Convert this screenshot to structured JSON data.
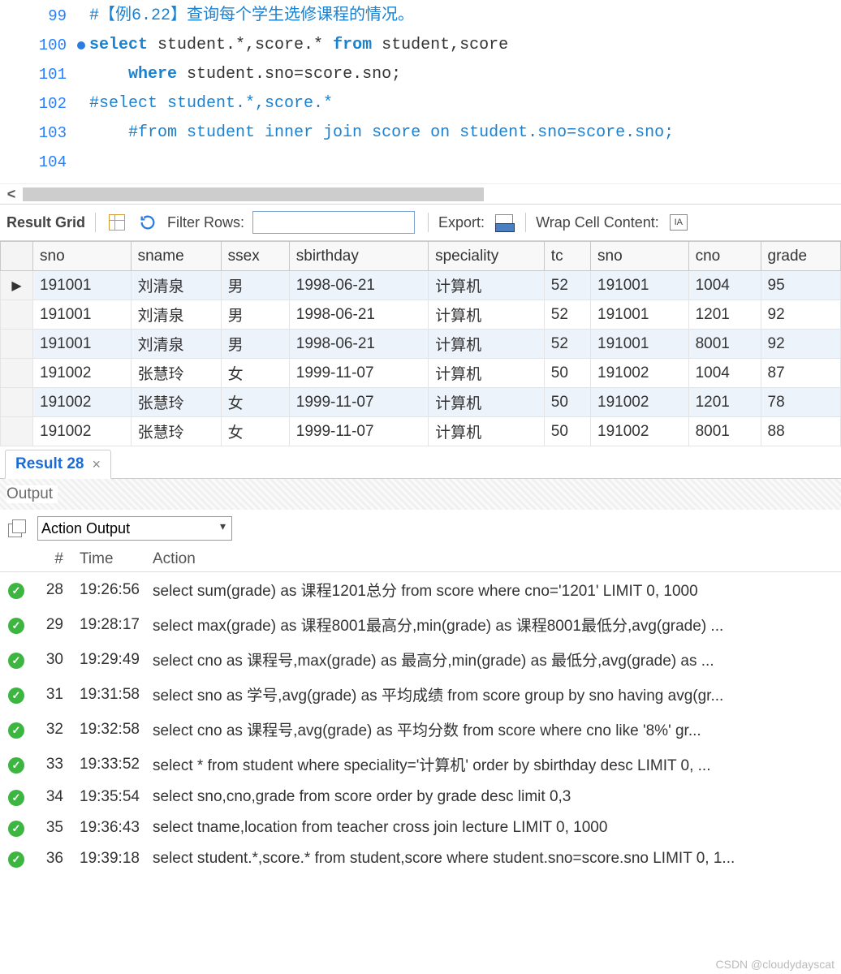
{
  "editor": {
    "lines": [
      {
        "num": "99",
        "bp": false,
        "indent": "",
        "segs": [
          [
            "cm",
            "#【例6.22】查询每个学生选修课程的情况。"
          ]
        ]
      },
      {
        "num": "100",
        "bp": true,
        "indent": "",
        "segs": [
          [
            "kw",
            "select"
          ],
          [
            "def",
            " student.*,score.* "
          ],
          [
            "kw",
            "from"
          ],
          [
            "def",
            " student,score"
          ]
        ]
      },
      {
        "num": "101",
        "bp": false,
        "indent": "    ",
        "segs": [
          [
            "kw",
            "where"
          ],
          [
            "def",
            " student.sno=score.sno;"
          ]
        ]
      },
      {
        "num": "102",
        "bp": false,
        "indent": "",
        "segs": [
          [
            "cm",
            "#select student.*,score.*"
          ]
        ]
      },
      {
        "num": "103",
        "bp": false,
        "indent": "    ",
        "segs": [
          [
            "cm",
            "#from student inner join score on student.sno=score.sno;"
          ]
        ]
      },
      {
        "num": "104",
        "bp": false,
        "indent": "",
        "segs": []
      }
    ]
  },
  "resultbar": {
    "title": "Result Grid",
    "filter_label": "Filter Rows:",
    "filter_value": "",
    "export_label": "Export:",
    "wrap_label": "Wrap Cell Content:",
    "wrap_icon_text": "IA"
  },
  "grid": {
    "columns": [
      "sno",
      "sname",
      "ssex",
      "sbirthday",
      "speciality",
      "tc",
      "sno",
      "cno",
      "grade"
    ],
    "rows": [
      [
        "191001",
        "刘清泉",
        "男",
        "1998-06-21",
        "计算机",
        "52",
        "191001",
        "1004",
        "95"
      ],
      [
        "191001",
        "刘清泉",
        "男",
        "1998-06-21",
        "计算机",
        "52",
        "191001",
        "1201",
        "92"
      ],
      [
        "191001",
        "刘清泉",
        "男",
        "1998-06-21",
        "计算机",
        "52",
        "191001",
        "8001",
        "92"
      ],
      [
        "191002",
        "张慧玲",
        "女",
        "1999-11-07",
        "计算机",
        "50",
        "191002",
        "1004",
        "87"
      ],
      [
        "191002",
        "张慧玲",
        "女",
        "1999-11-07",
        "计算机",
        "50",
        "191002",
        "1201",
        "78"
      ],
      [
        "191002",
        "张慧玲",
        "女",
        "1999-11-07",
        "计算机",
        "50",
        "191002",
        "8001",
        "88"
      ]
    ],
    "row_marker": "▶"
  },
  "restab": {
    "label": "Result 28",
    "close": "×"
  },
  "output": {
    "header": "Output",
    "select_value": "Action Output",
    "columns": {
      "num": "#",
      "time": "Time",
      "action": "Action"
    },
    "rows": [
      {
        "n": "28",
        "t": "19:26:56",
        "a": "select sum(grade) as 课程1201总分 from score where cno='1201' LIMIT 0, 1000"
      },
      {
        "n": "29",
        "t": "19:28:17",
        "a": "select max(grade) as 课程8001最高分,min(grade) as 课程8001最低分,avg(grade) ..."
      },
      {
        "n": "30",
        "t": "19:29:49",
        "a": "select cno as 课程号,max(grade) as 最高分,min(grade) as 最低分,avg(grade) as ..."
      },
      {
        "n": "31",
        "t": "19:31:58",
        "a": "select sno as 学号,avg(grade) as 平均成绩 from score group by sno having avg(gr..."
      },
      {
        "n": "32",
        "t": "19:32:58",
        "a": "select cno as 课程号,avg(grade) as 平均分数 from score where cno like '8%'    gr..."
      },
      {
        "n": "33",
        "t": "19:33:52",
        "a": "select * from student where speciality='计算机'    order by sbirthday desc LIMIT 0, ..."
      },
      {
        "n": "34",
        "t": "19:35:54",
        "a": "select sno,cno,grade from score order by grade desc    limit 0,3"
      },
      {
        "n": "35",
        "t": "19:36:43",
        "a": "select tname,location from teacher cross join lecture LIMIT 0, 1000"
      },
      {
        "n": "36",
        "t": "19:39:18",
        "a": "select student.*,score.* from student,score where student.sno=score.sno LIMIT 0, 1..."
      }
    ]
  },
  "watermark": "CSDN @cloudydayscat"
}
